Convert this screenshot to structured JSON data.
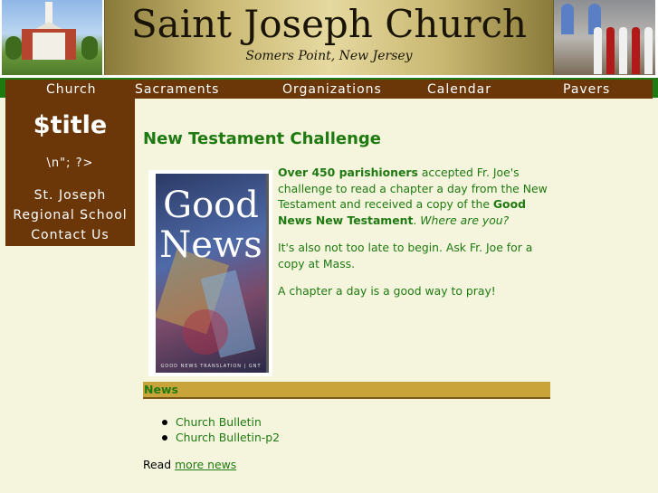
{
  "header": {
    "title": "Saint Joseph Church",
    "subtitle": "Somers Point, New Jersey"
  },
  "nav": {
    "items": [
      {
        "label": "Church"
      },
      {
        "label": "Sacraments"
      },
      {
        "label": "Organizations"
      },
      {
        "label": "Calendar"
      },
      {
        "label": "Pavers"
      }
    ]
  },
  "sidebar": {
    "title": "$title",
    "code": "\\n\"; ?>",
    "links": [
      {
        "label": "St. Joseph"
      },
      {
        "label": "Regional School"
      },
      {
        "label": "Contact Us"
      }
    ]
  },
  "main": {
    "page_title": "New Testament Challenge",
    "book": {
      "word1": "Good",
      "word2": "News",
      "footer": "GOOD NEWS TRANSLATION | GNT"
    },
    "intro": {
      "p1_bold1": "Over 450 parishioners",
      "p1_text1": " accepted Fr. Joe's challenge to read a chapter a day from the New Testament and received a copy of the ",
      "p1_bold2": "Good News New Testament",
      "p1_text2": ". ",
      "p1_italic": "Where are you?",
      "p2": "It's also not too late to begin. Ask Fr. Joe for a copy at Mass.",
      "p3": "A chapter a day is a good way to pray!"
    },
    "news": {
      "header": "News",
      "items": [
        {
          "label": "Church Bulletin"
        },
        {
          "label": "Church Bulletin-p2"
        }
      ],
      "more_prefix": "Read ",
      "more_link": "more news"
    }
  },
  "colors": {
    "page_bg": "#f5f4dc",
    "nav_brown": "#6b3708",
    "green_bar": "#1f7a12",
    "text_green": "#1f7a12",
    "news_header_gold": "#c9a43a"
  }
}
